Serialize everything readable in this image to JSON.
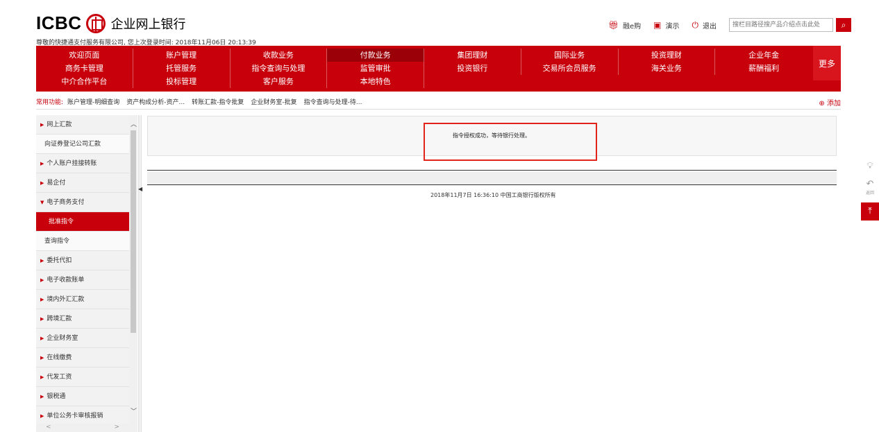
{
  "header": {
    "logo_text": "ICBC",
    "bank_name": "企业网上银行",
    "welcome": "尊敬的快捷通支付服务有限公司, 您上次登录时间: 2018年11月06日 20:13:39",
    "links": [
      {
        "label": "融e购",
        "icon": "gift-icon"
      },
      {
        "label": "演示",
        "icon": "play-icon"
      },
      {
        "label": "退出",
        "icon": "power-icon"
      }
    ],
    "search_placeholder": "搜栏目路径搜产品介绍点击此处"
  },
  "nav": {
    "items": [
      "欢迎页面",
      "账户管理",
      "收款业务",
      "付款业务",
      "集团理财",
      "国际业务",
      "投资理财",
      "企业年金",
      "商务卡管理",
      "托管服务",
      "指令查询与处理",
      "监管审批",
      "投资银行",
      "交易所会员服务",
      "海关业务",
      "薪酬福利",
      "中介合作平台",
      "投标管理",
      "客户服务",
      "本地特色"
    ],
    "active": "付款业务",
    "more": "更多"
  },
  "quick": {
    "label": "常用功能:",
    "items": [
      "账户管理-明细查询",
      "资产构成分析-资产...",
      "转账汇款-指令批复",
      "企业财务室-批复",
      "指令查询与处理-待..."
    ],
    "add": "添加"
  },
  "sidebar": {
    "items": [
      {
        "label": "网上汇款",
        "type": "group"
      },
      {
        "label": "向证券登记公司汇款",
        "type": "sub"
      },
      {
        "label": "个人账户挂接转账",
        "type": "group"
      },
      {
        "label": "易企付",
        "type": "group"
      },
      {
        "label": "电子商务支付",
        "type": "open"
      },
      {
        "label": "批准指令",
        "type": "active"
      },
      {
        "label": "查询指令",
        "type": "sub"
      },
      {
        "label": "委托代扣",
        "type": "group"
      },
      {
        "label": "电子收款账单",
        "type": "group"
      },
      {
        "label": "境内外汇汇款",
        "type": "group"
      },
      {
        "label": "跨境汇款",
        "type": "group"
      },
      {
        "label": "企业财务室",
        "type": "group"
      },
      {
        "label": "在线缴费",
        "type": "group"
      },
      {
        "label": "代发工资",
        "type": "group"
      },
      {
        "label": "银税通",
        "type": "group"
      },
      {
        "label": "单位公务卡审核报销",
        "type": "group"
      }
    ]
  },
  "main": {
    "message": "指令授权成功，等待银行处理。",
    "footer": "2018年11月7日 16:36:10  中国工商银行版权所有"
  },
  "tools": {
    "back_label": "返回"
  },
  "colors": {
    "brand": "#c7000b",
    "highlight_border": "#e2231a"
  }
}
